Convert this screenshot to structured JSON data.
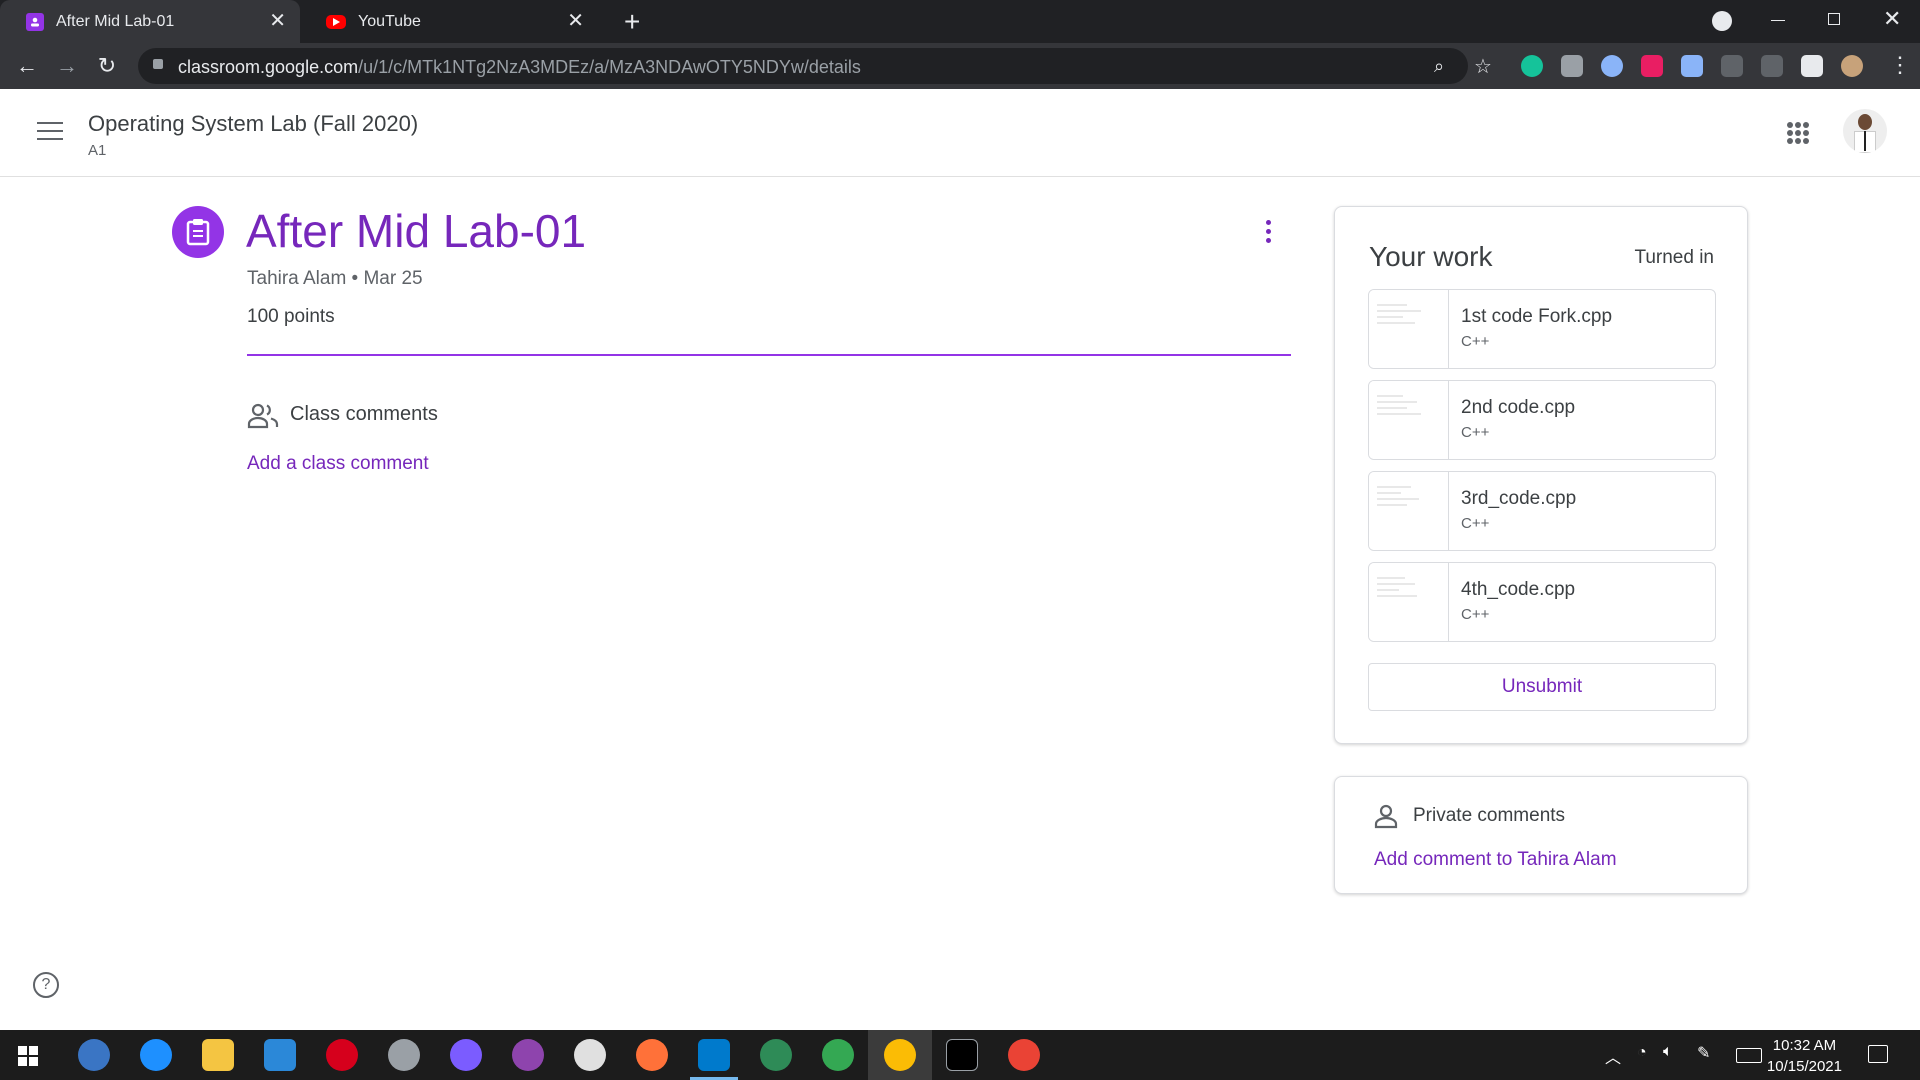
{
  "browser": {
    "tabs": [
      {
        "title": "After Mid Lab-01",
        "active": true,
        "favicon": "classroom-icon",
        "color": "#9334e6"
      },
      {
        "title": "YouTube",
        "active": false,
        "favicon": "youtube-icon",
        "color": "#ff0000"
      }
    ],
    "url_host": "classroom.google.com",
    "url_path": "/u/1/c/MTk1NTg2NzA3MDEz/a/MzA3NDAwOTY5NDYw/details"
  },
  "header": {
    "course_title": "Operating System Lab (Fall 2020)",
    "section": "A1"
  },
  "assignment": {
    "title": "After Mid Lab-01",
    "meta": "Tahira Alam • Mar 25",
    "points": "100 points",
    "class_comments_label": "Class comments",
    "add_class_comment": "Add a class comment"
  },
  "your_work": {
    "title": "Your work",
    "status": "Turned in",
    "files": [
      {
        "name": "1st code Fork.cpp",
        "type": "C++"
      },
      {
        "name": "2nd code.cpp",
        "type": "C++"
      },
      {
        "name": "3rd_code.cpp",
        "type": "C++"
      },
      {
        "name": "4th_code.cpp",
        "type": "C++"
      }
    ],
    "unsubmit_label": "Unsubmit"
  },
  "private_comments": {
    "label": "Private comments",
    "add_label": "Add comment to Tahira Alam"
  },
  "taskbar": {
    "time": "10:32 AM",
    "date": "10/15/2021"
  },
  "colors": {
    "accent": "#7627bb",
    "accent_circle": "#9334e6"
  }
}
